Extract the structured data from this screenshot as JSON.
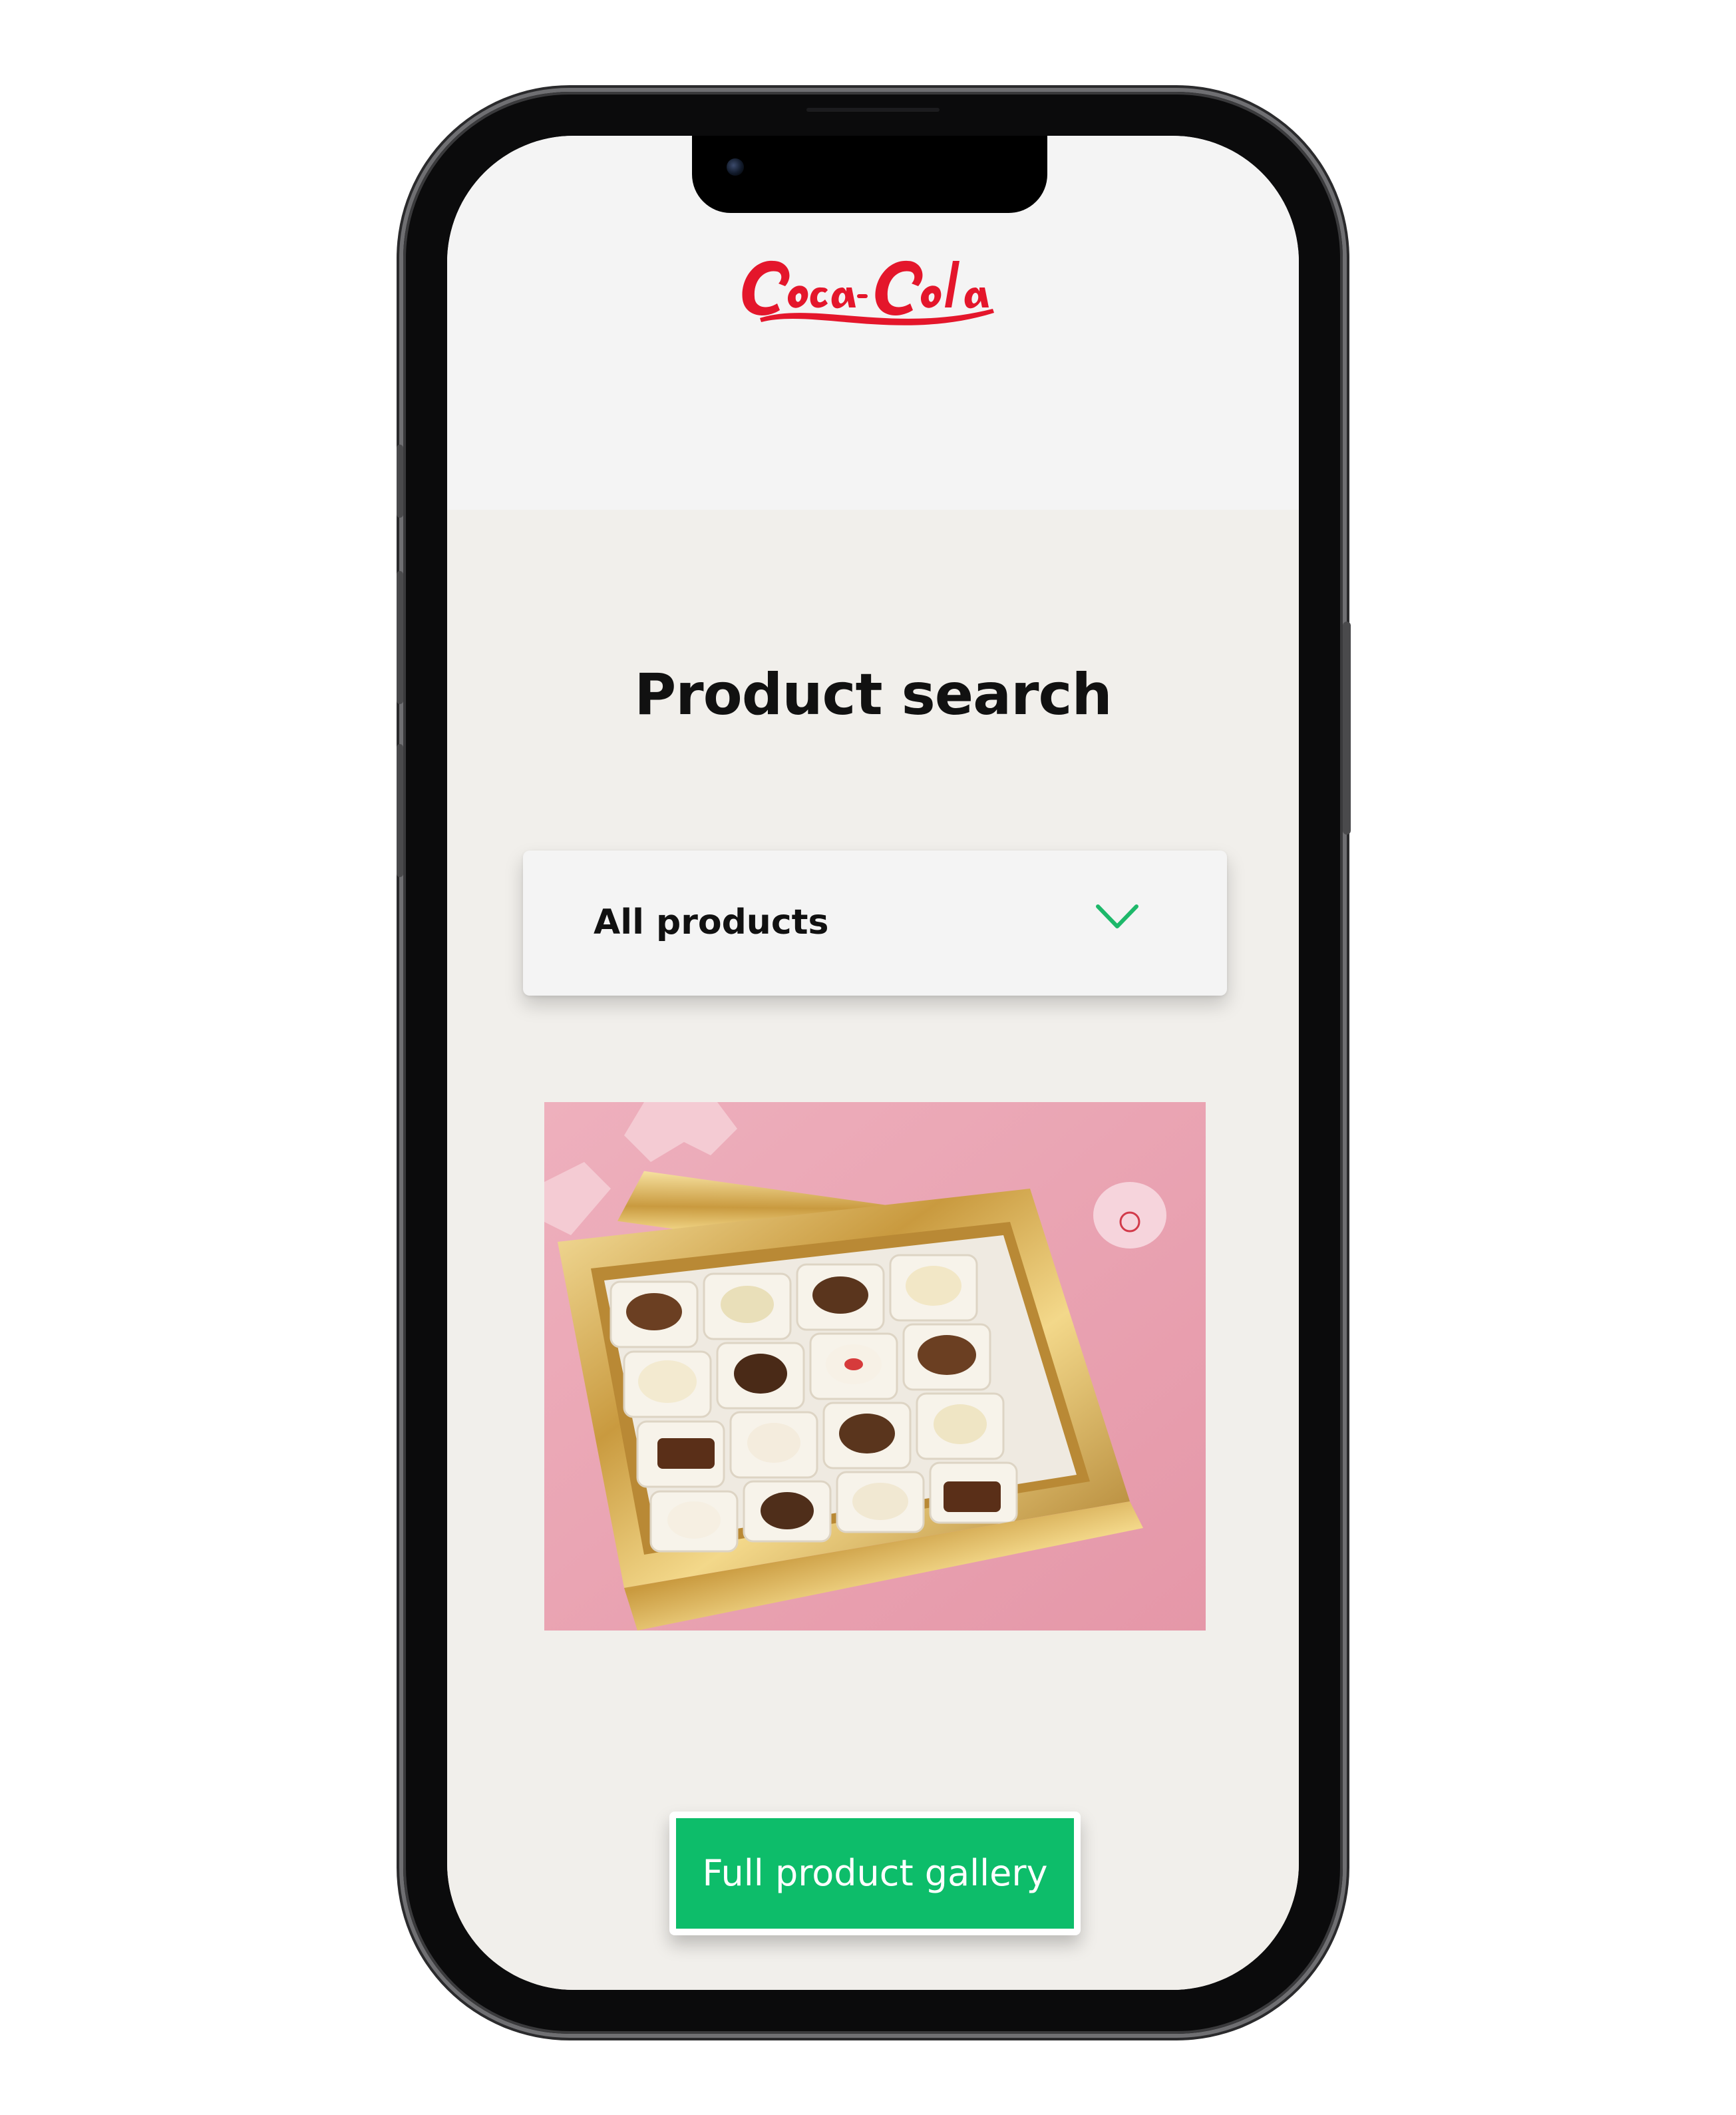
{
  "header": {
    "brand_logo": "Coca-Cola",
    "brand_color": "#e4162b"
  },
  "main": {
    "title": "Product search",
    "filter": {
      "selected": "All products",
      "icon": "chevron-down-icon",
      "icon_color": "#1db86a"
    },
    "product_image": {
      "subject": "box of assorted chocolates"
    },
    "cta": {
      "label": "Full product gallery",
      "color": "#0dbd6a"
    }
  }
}
